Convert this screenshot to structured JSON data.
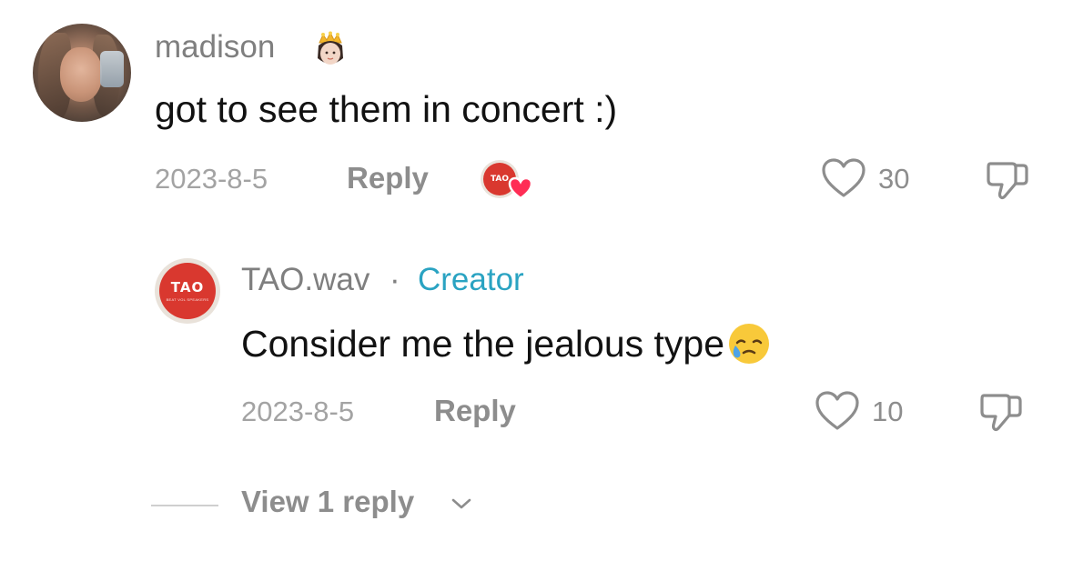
{
  "comment": {
    "username": "madison",
    "username_emoji": "crown-princess-emoji",
    "text": "got to see them in concert :)",
    "date": "2023-8-5",
    "reply_label": "Reply",
    "likes": "30",
    "liked_by_creator_badge": "TAO"
  },
  "reply": {
    "username": "TAO.wav",
    "separator": "·",
    "role": "Creator",
    "text": "Consider me the jealous type",
    "text_emoji": "face-holding-back-tears",
    "date": "2023-8-5",
    "reply_label": "Reply",
    "likes": "10",
    "avatar_logo": "TAO",
    "avatar_logo_sub": "BEAT VOL SPEAKERS"
  },
  "thread": {
    "view_replies_label": "View 1 reply"
  },
  "colors": {
    "creator_accent": "#2aa3c2",
    "heart_red": "#ff2d55",
    "muted_text": "#8d8d8d",
    "tao_red": "#d9382f"
  }
}
